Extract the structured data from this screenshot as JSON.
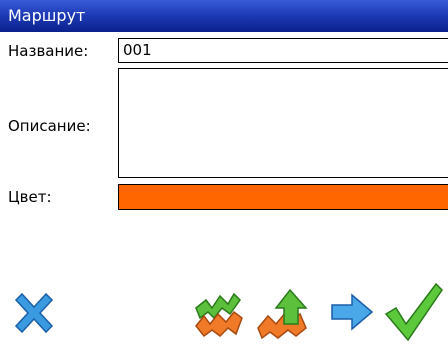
{
  "window": {
    "title": "Маршрут"
  },
  "form": {
    "name_label": "Название:",
    "name_value": "001",
    "description_label": "Описание:",
    "description_value": "",
    "color_label": "Цвет:",
    "color_value": "#ff6600"
  },
  "toolbar": {
    "icons": [
      "close-icon",
      "zigzag-arrows-icon",
      "up-arrow-zigzag-icon",
      "arrow-right-icon",
      "checkmark-icon"
    ]
  },
  "colors": {
    "titlebar": "#1e3cb8",
    "route_color": "#ff6600",
    "close": "#2a8ad8",
    "ok": "#3cb83c"
  }
}
